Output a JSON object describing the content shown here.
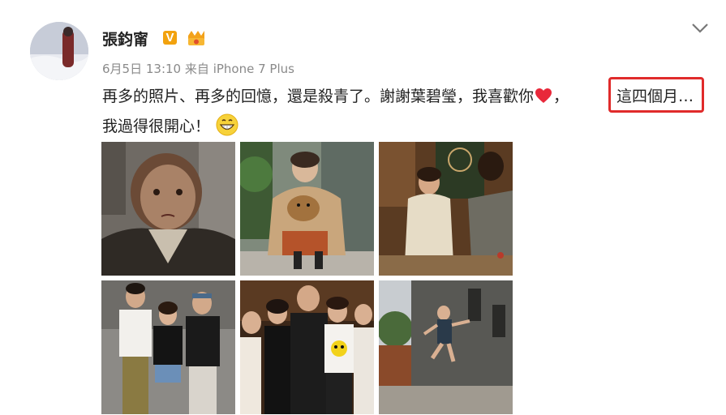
{
  "post": {
    "author": "張鈞甯",
    "verified_badge": "V",
    "date": "6月5日",
    "time": "13:10",
    "source_prefix": "来自",
    "source": "iPhone 7 Plus",
    "text_part1": "再多的照片、再多的回憶，還是殺青了。謝謝葉碧瑩，我喜歡你",
    "text_part2": "，",
    "text_more": "這四個月…",
    "text_line2": "我過得很開心！",
    "photo_count": 6,
    "colors": {
      "badge": "#f2a20e",
      "highlight_border": "#e02b2b",
      "meta_text": "#8a8a8a"
    },
    "icons": [
      "heart-emoji",
      "grin-emoji",
      "chevron-down-icon",
      "vip-badge-icon"
    ]
  }
}
